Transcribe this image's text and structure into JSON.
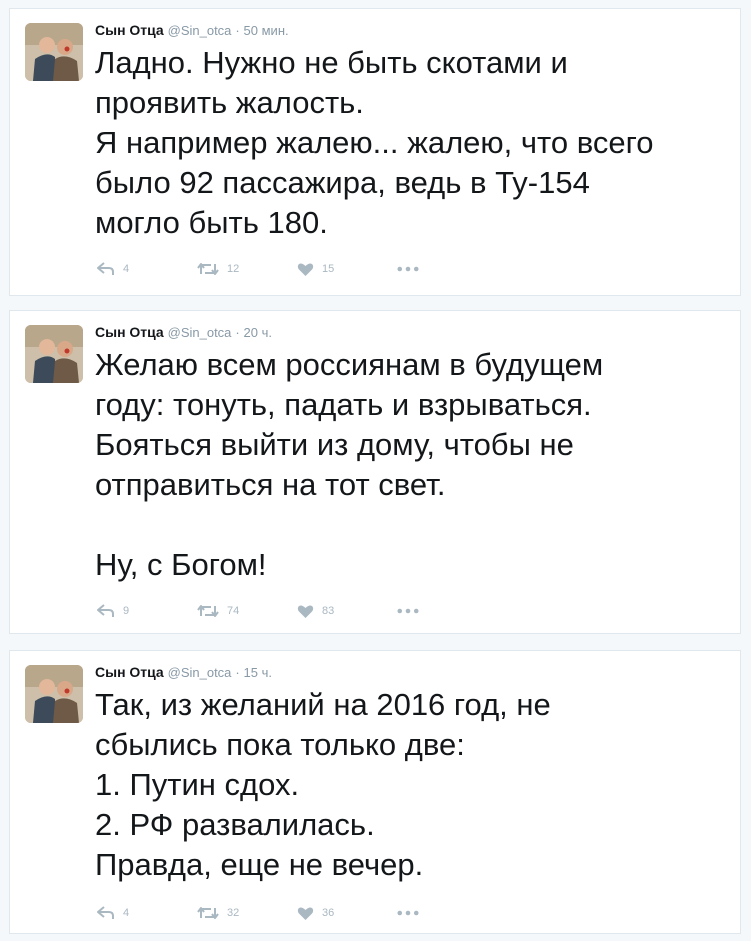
{
  "colors": {
    "name": "#14171a",
    "muted": "#8899a6",
    "icon": "#aab8c2",
    "border": "#e1e8ed"
  },
  "tweets": [
    {
      "author": {
        "name": "Сын Отца",
        "handle": "@Sin_otca",
        "time": "50 мин."
      },
      "lines": [
        "Ладно. Нужно не быть скотами и",
        "проявить жалость.",
        "Я например жалею... жалею, что всего",
        "было 92 пассажира, ведь в Ту-154",
        "могло быть 180."
      ],
      "counts": {
        "reply": "4",
        "retweet": "12",
        "like": "15"
      }
    },
    {
      "author": {
        "name": "Сын Отца",
        "handle": "@Sin_otca",
        "time": "20 ч."
      },
      "lines": [
        "Желаю всем россиянам в будущем",
        "году: тонуть, падать и взрываться.",
        "Бояться выйти из дому, чтобы не",
        "отправиться на тот свет.",
        "",
        "Ну, с Богом!"
      ],
      "counts": {
        "reply": "9",
        "retweet": "74",
        "like": "83"
      }
    },
    {
      "author": {
        "name": "Сын Отца",
        "handle": "@Sin_otca",
        "time": "15 ч."
      },
      "lines": [
        "Так, из желаний на 2016 год, не",
        "сбылись пока только две:",
        "1. Путин сдох.",
        "2. РФ развалилась.",
        "Правда, еще не вечер."
      ],
      "counts": {
        "reply": "4",
        "retweet": "32",
        "like": "36"
      }
    }
  ],
  "icons": {
    "reply": "reply-icon",
    "retweet": "retweet-icon",
    "like": "heart-icon",
    "more": "more-icon"
  }
}
